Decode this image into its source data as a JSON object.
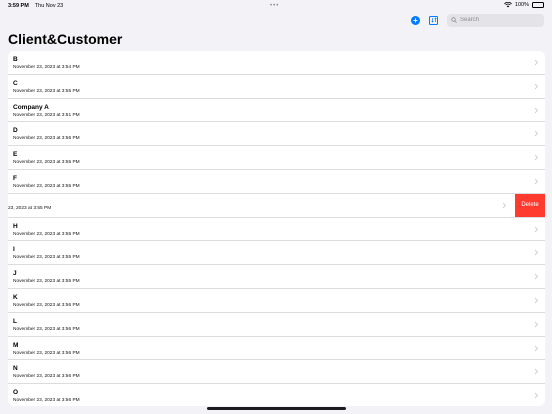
{
  "status_bar": {
    "time": "3:59 PM",
    "date": "Thu Nov 23",
    "battery": "100%"
  },
  "toolbar": {
    "add_icon": "plus-circle-icon",
    "sort_icon": "sort-icon",
    "search_placeholder": "Search"
  },
  "page": {
    "title": "Client&Customer"
  },
  "rows": [
    {
      "name": "B",
      "date": "November 23, 2023 at 3:54 PM"
    },
    {
      "name": "C",
      "date": "November 23, 2023 at 3:55 PM"
    },
    {
      "name": "Company A",
      "date": "November 23, 2023 at 3:51 PM"
    },
    {
      "name": "D",
      "date": "November 23, 2023 at 3:56 PM"
    },
    {
      "name": "E",
      "date": "November 23, 2023 at 3:55 PM"
    },
    {
      "name": "F",
      "date": "November 23, 2023 at 3:55 PM"
    },
    {
      "name": "",
      "date": "23, 2023 at 3:55 PM",
      "delete_label": "Delete"
    },
    {
      "name": "H",
      "date": "November 23, 2023 at 3:55 PM"
    },
    {
      "name": "I",
      "date": "November 23, 2023 at 3:55 PM"
    },
    {
      "name": "J",
      "date": "November 23, 2023 at 3:55 PM"
    },
    {
      "name": "K",
      "date": "November 23, 2023 at 3:56 PM"
    },
    {
      "name": "L",
      "date": "November 23, 2023 at 3:56 PM"
    },
    {
      "name": "M",
      "date": "November 23, 2023 at 3:56 PM"
    },
    {
      "name": "N",
      "date": "November 23, 2023 at 3:56 PM"
    },
    {
      "name": "O",
      "date": "November 23, 2023 at 3:56 PM"
    }
  ],
  "colors": {
    "accent": "#007aff",
    "destructive": "#ff3b30",
    "background": "#f2f2f7"
  }
}
